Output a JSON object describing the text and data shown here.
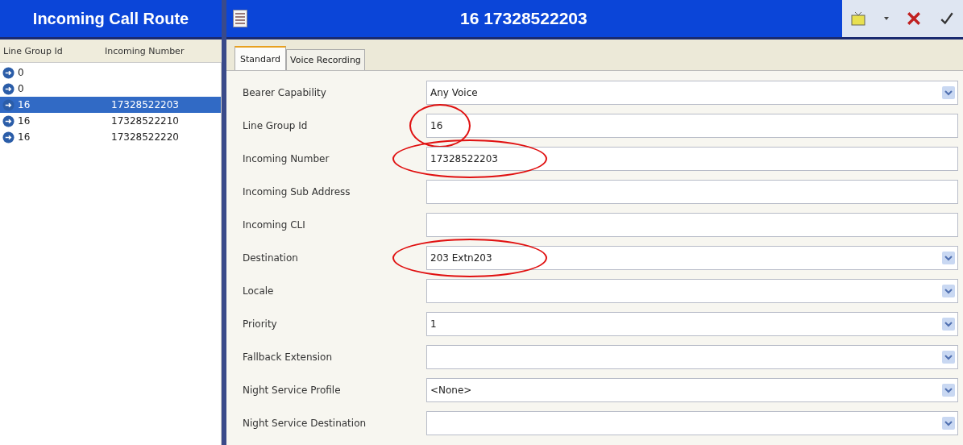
{
  "left_panel": {
    "title": "Incoming Call Route",
    "columns": [
      "Line Group Id",
      "Incoming Number"
    ],
    "rows": [
      {
        "line_group_id": "0",
        "selected": false
      },
      {
        "line_group_id": "0",
        "selected": false
      },
      {
        "line_group_id": "16",
        "incoming_number": "17328522203",
        "selected": true
      },
      {
        "line_group_id": "16",
        "incoming_number": "17328522210",
        "selected": false
      },
      {
        "line_group_id": "16",
        "incoming_number": "17328522220",
        "selected": false
      }
    ]
  },
  "detail": {
    "title": "16 17328522203",
    "tabs": [
      {
        "label": "Standard",
        "selected": true
      },
      {
        "label": "Voice Recording",
        "selected": false
      }
    ],
    "fields": [
      {
        "label": "Bearer Capability",
        "kind": "dropdown",
        "value": "Any Voice",
        "circled": false
      },
      {
        "label": "Line Group Id",
        "kind": "text",
        "value": "16",
        "circled": true
      },
      {
        "label": "Incoming Number",
        "kind": "text",
        "value": "17328522203",
        "circled": true
      },
      {
        "label": "Incoming Sub Address",
        "kind": "text",
        "circled": false
      },
      {
        "label": "Incoming CLI",
        "kind": "text",
        "circled": false
      },
      {
        "label": "Destination",
        "kind": "dropdown",
        "value": "203 Extn203",
        "circled": true
      },
      {
        "label": "Locale",
        "kind": "dropdown",
        "circled": false
      },
      {
        "label": "Priority",
        "kind": "dropdown",
        "value": "1",
        "circled": false
      },
      {
        "label": "Fallback Extension",
        "kind": "dropdown",
        "circled": false
      },
      {
        "label": "Night Service Profile",
        "kind": "dropdown",
        "value": "<None>",
        "circled": false
      },
      {
        "label": "Night Service Destination",
        "kind": "dropdown",
        "circled": false
      }
    ]
  }
}
